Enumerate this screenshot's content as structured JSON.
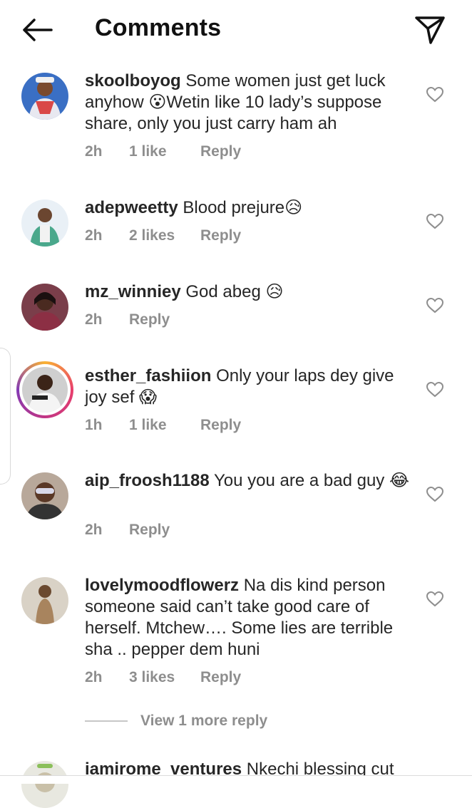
{
  "header": {
    "title": "Comments"
  },
  "comments": [
    {
      "username": "skoolboyog",
      "text": "Some women just get luck anyhow 😮Wetin like 10 lady’s suppose share, only you just carry ham ah",
      "time": "2h",
      "likes": "1 like",
      "reply": "Reply"
    },
    {
      "username": "adepweetty",
      "text": "Blood prejure😥",
      "time": "2h",
      "likes": "2 likes",
      "reply": "Reply"
    },
    {
      "username": "mz_winniey",
      "text": "God abeg 😥",
      "time": "2h",
      "likes": "",
      "reply": "Reply"
    },
    {
      "username": "esther_fashiion",
      "text": "Only your laps dey give joy sef 😱",
      "time": "1h",
      "likes": "1 like",
      "reply": "Reply"
    },
    {
      "username": "aip_froosh1188",
      "text": "You you are a bad guy 😂",
      "time": "2h",
      "likes": "",
      "reply": "Reply"
    },
    {
      "username": "lovelymoodflowerz",
      "text": "Na dis kind person someone said can’t take good care of herself. Mtchew…. Some lies are terrible sha .. pepper dem huni",
      "time": "2h",
      "likes": "3 likes",
      "reply": "Reply"
    },
    {
      "username": "iamirome_ventures",
      "text": "Nkechi blessing cut",
      "time": "",
      "likes": "",
      "reply": ""
    }
  ],
  "view_more": {
    "label": "View 1 more reply"
  },
  "icons": {
    "back": "arrow-left-icon",
    "share": "paper-plane-icon",
    "like": "heart-outline-icon"
  },
  "colors": {
    "text": "#262626",
    "secondary": "#8e8e8e",
    "story_ring": "#c13584"
  }
}
